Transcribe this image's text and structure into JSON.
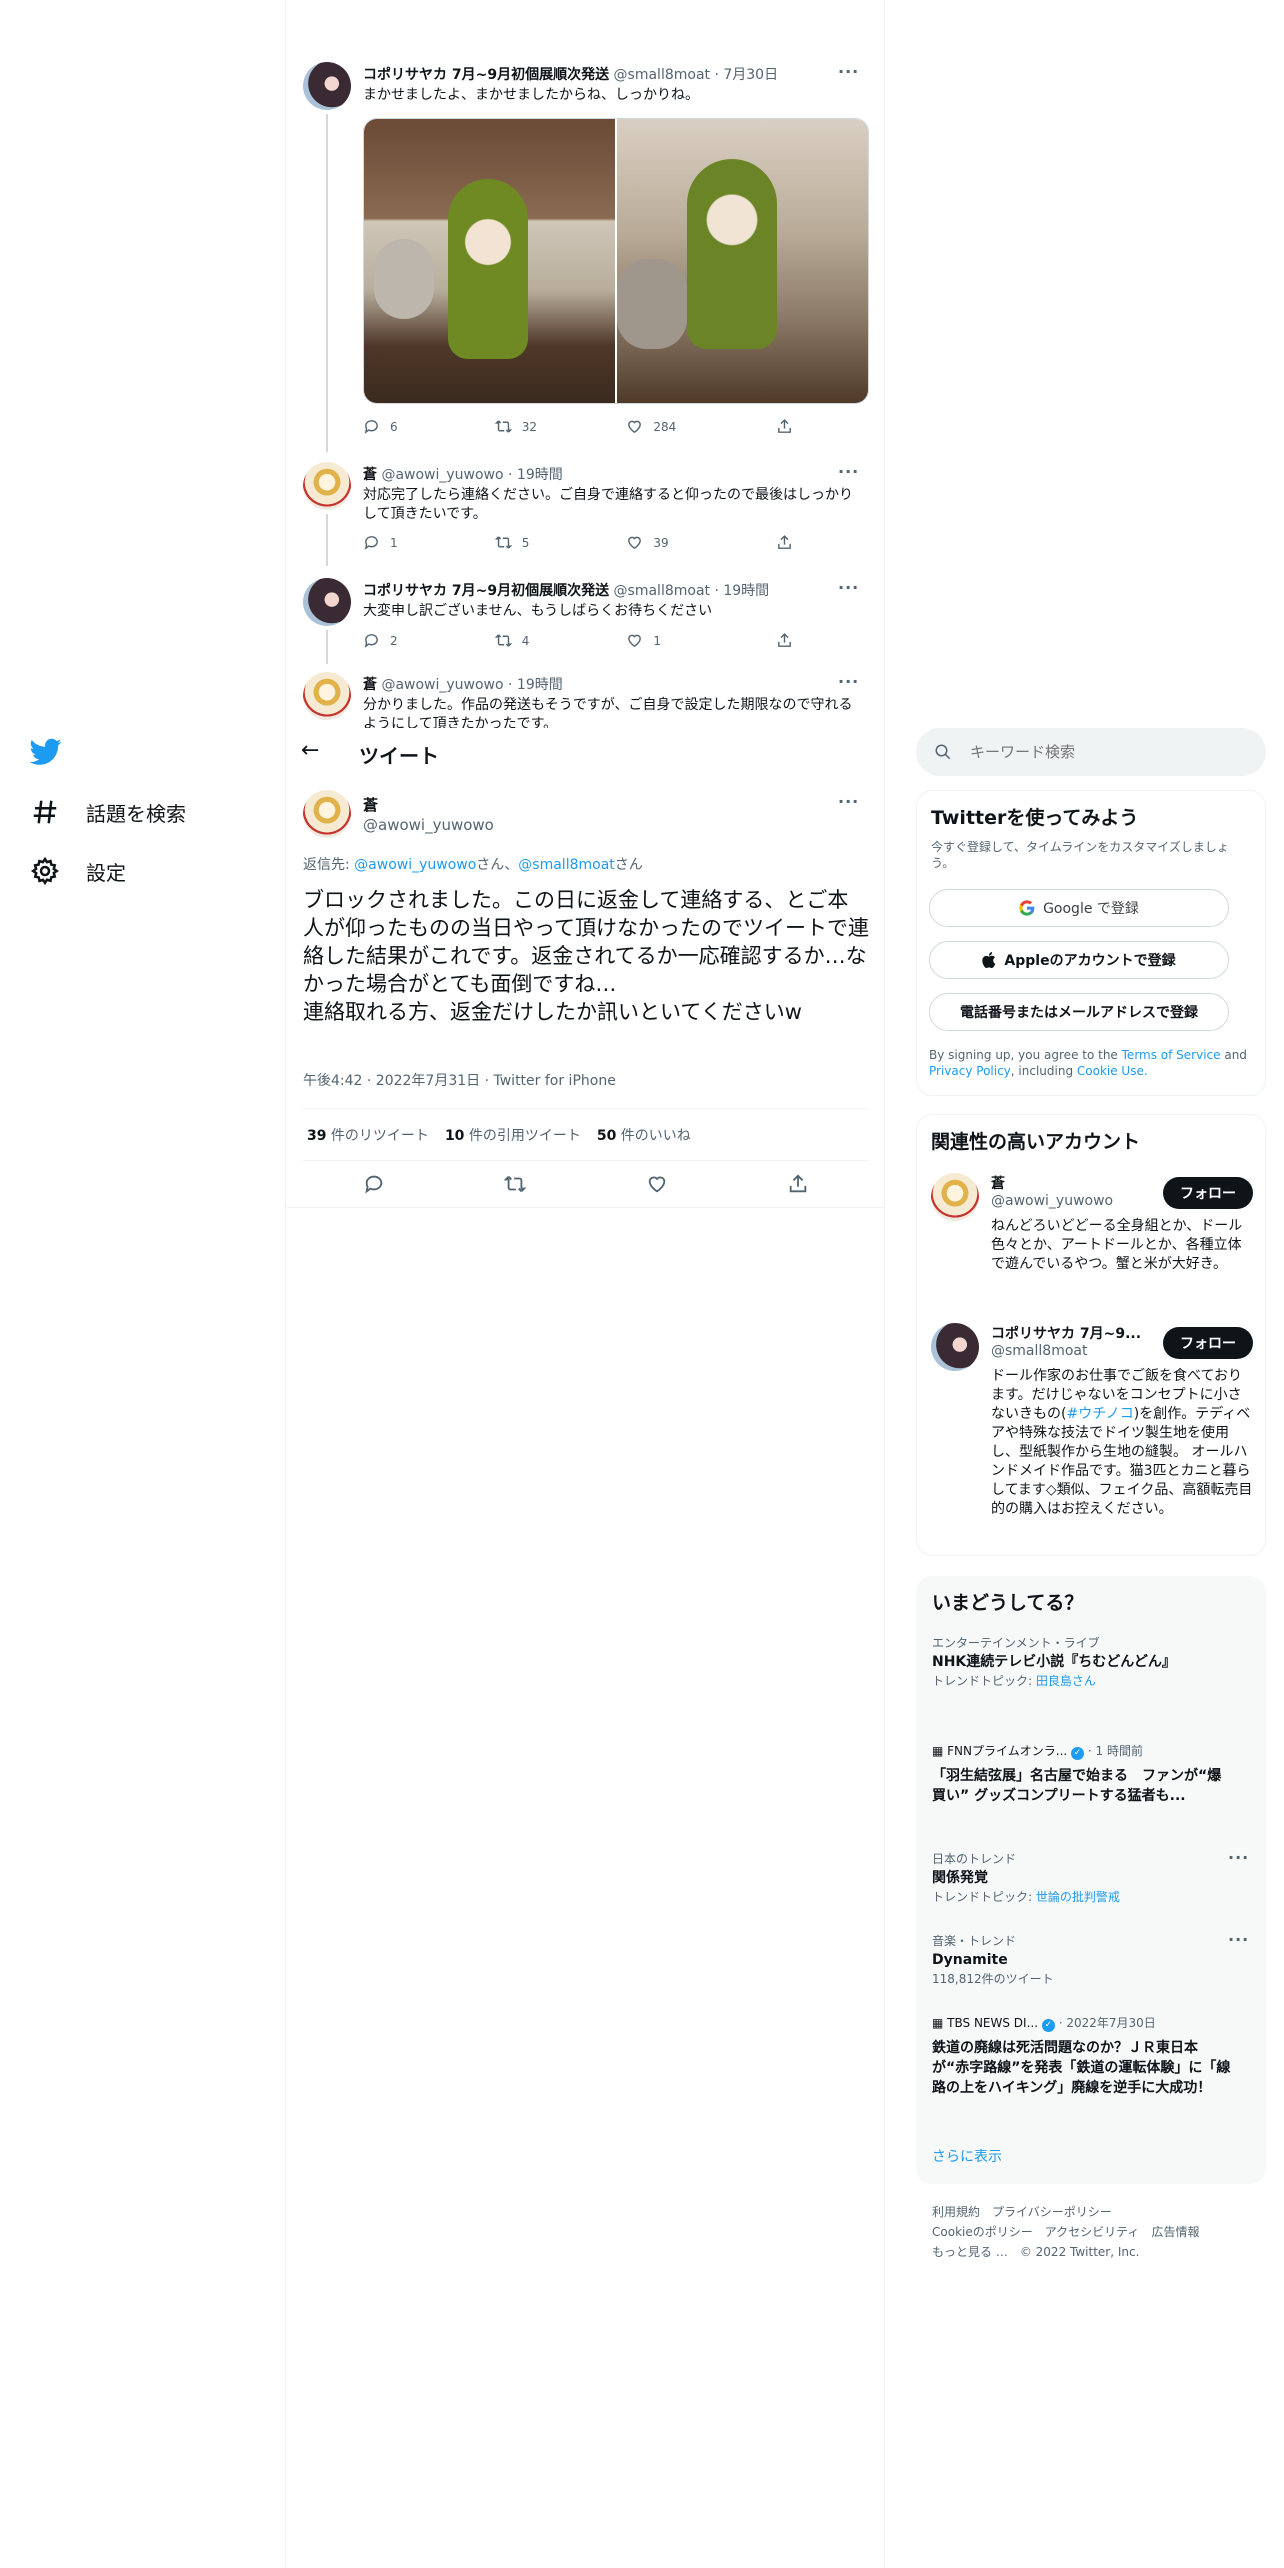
{
  "nav": {
    "logo": "twitter-bird",
    "items": [
      {
        "label": "話題を検索",
        "icon": "hashtag-icon"
      },
      {
        "label": "設定",
        "icon": "gear-icon"
      }
    ]
  },
  "thread": [
    {
      "name": "コポリサヤカ 7月~9月初個展順次発送",
      "handle": "@small8moat",
      "time": "· 7月30日",
      "text": "まかせましたよ、まかせましたからね、しっかりね。",
      "media": [
        "cat-doll-green-hood-photo-1",
        "cat-doll-green-hood-photo-2"
      ],
      "replies": "6",
      "retweets": "32",
      "likes": "284"
    },
    {
      "name": "蒼",
      "handle": "@awowi_yuwowo",
      "time": "· 19時間",
      "text": "対応完了したら連絡ください。ご自身で連絡すると仰ったので最後はしっかりして頂きたいです。",
      "replies": "1",
      "retweets": "5",
      "likes": "39"
    },
    {
      "name": "コポリサヤカ 7月~9月初個展順次発送",
      "handle": "@small8moat",
      "time": "· 19時間",
      "text": "大変申し訳ございません、もうしばらくお待ちください",
      "replies": "2",
      "retweets": "4",
      "likes": "1"
    },
    {
      "name": "蒼",
      "handle": "@awowi_yuwowo",
      "time": "· 19時間",
      "text": "分かりました。作品の発送もそうですが、ご自身で設定した期限なので守れるようにして頂きたかったです。"
    }
  ],
  "header": {
    "back": "←",
    "title": "ツイート"
  },
  "main_tweet": {
    "name": "蒼",
    "handle": "@awowi_yuwowo",
    "reply_prefix": "返信先: ",
    "reply_to_1": "@awowi_yuwowo",
    "san_1": "さん、",
    "reply_to_2": "@small8moat",
    "san_2": "さん",
    "text": "ブロックされました。この日に返金して連絡する、とご本人が仰ったものの当日やって頂けなかったのでツイートで連絡した結果がこれです。返金されてるか一応確認するか…なかった場合がとても面倒ですね…\n連絡取れる方、返金だけしたか訊いといてくださいw",
    "timestamp": "午後4:42 · 2022年7月31日 · Twitter for iPhone",
    "retweets_num": "39",
    "retweets_label": " 件のリツイート",
    "quotes_num": "10",
    "quotes_label": " 件の引用ツイート",
    "likes_num": "50",
    "likes_label": " 件のいいね"
  },
  "search": {
    "placeholder": "キーワード検索"
  },
  "signup": {
    "title": "Twitterを使ってみよう",
    "subtitle": "今すぐ登録して、タイムラインをカスタマイズしましょう。",
    "google": "Google で登録",
    "apple": "Appleのアカウントで登録",
    "phone": "電話番号またはメールアドレスで登録",
    "legal_1": "By signing up, you agree to the ",
    "terms": "Terms of Service",
    "legal_2": " and ",
    "privacy": "Privacy Policy",
    "legal_3": ", including ",
    "cookie": "Cookie Use."
  },
  "relevant": {
    "title": "関連性の高いアカウント",
    "accounts": [
      {
        "name": "蒼",
        "handle": "@awowi_yuwowo",
        "follow": "フォロー",
        "bio": "ねんどろいどどーる全身組とか、ドール色々とか、アートドールとか、各種立体で遊んでいるやつ。蟹と米が大好き。"
      },
      {
        "name": "コポリサヤカ 7月~9...",
        "handle": "@small8moat",
        "follow": "フォロー",
        "bio_1": "ドール作家のお仕事でご飯を食べております。だけじゃないをコンセプトに小さないきもの(",
        "bio_tag": "#ウチノコ",
        "bio_2": ")を創作。テディベアや特殊な技法でドイツ製生地を使用し、型紙製作から生地の縫製。 オールハンドメイド作品です。猫3匹とカニと暮らしてます◇類似、フェイク品、高額転売目的の購入はお控えください。"
      }
    ]
  },
  "trends": {
    "title": "いまどうしてる？",
    "items": [
      {
        "meta": "エンターテインメント・ライブ",
        "title": "NHK連続テレビ小説『ちむどんどん』",
        "sub_label": "トレンドトピック: ",
        "sub_link": "田良島さん"
      },
      {
        "source": "FNNプライムオンラ...",
        "time": "· 1 時間前",
        "title": "「羽生結弦展」名古屋で始まる　ファンが“爆買い” グッズコンプリートする猛者も..."
      },
      {
        "meta": "日本のトレンド",
        "title": "関係発覚",
        "sub_label": "トレンドトピック: ",
        "sub_link": "世論の批判警戒"
      },
      {
        "meta": "音楽・トレンド",
        "title": "Dynamite",
        "count": "118,812件のツイート"
      },
      {
        "source": "TBS NEWS DI...",
        "time": "· 2022年7月30日",
        "title": "鉄道の廃線は死活問題なのか？ＪＲ東日本が“赤字路線”を発表「鉄道の運転体験」に「線路の上をハイキング」廃線を逆手に大成功！"
      }
    ],
    "more": "さらに表示"
  },
  "footer": {
    "line1": [
      "利用規約",
      "プライバシーポリシー"
    ],
    "line2": [
      "Cookieのポリシー",
      "アクセシビリティ",
      "広告情報"
    ],
    "more": "もっと見る …",
    "copyright": "© 2022 Twitter, Inc."
  }
}
